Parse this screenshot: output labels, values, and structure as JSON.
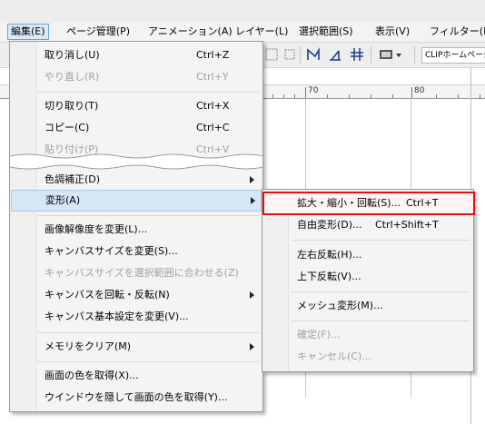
{
  "menubar": {
    "items": [
      {
        "label": "編集(E)"
      },
      {
        "label": "ページ管理(P)"
      },
      {
        "label": "アニメーション(A)"
      },
      {
        "label": "レイヤー(L)"
      },
      {
        "label": "選択範囲(S)"
      },
      {
        "label": "表示(V)"
      },
      {
        "label": "フィルター(I)"
      }
    ]
  },
  "toolbar": {
    "clip_label": "CLIPホームページ"
  },
  "ruler": {
    "labels": [
      "70",
      "80"
    ]
  },
  "edit_menu": {
    "items": [
      {
        "label": "取り消し(U)",
        "shortcut": "Ctrl+Z",
        "enabled": true
      },
      {
        "label": "やり直し(R)",
        "shortcut": "Ctrl+Y",
        "enabled": false
      },
      {
        "label": "切り取り(T)",
        "shortcut": "Ctrl+X",
        "enabled": true
      },
      {
        "label": "コピー(C)",
        "shortcut": "Ctrl+C",
        "enabled": true
      },
      {
        "label": "貼り付け(P)",
        "shortcut": "Ctrl+V",
        "enabled": false
      },
      {
        "label": "色調補正(D)",
        "submenu": true,
        "enabled": true
      },
      {
        "label": "変形(A)",
        "submenu": true,
        "enabled": true,
        "highlighted": true
      },
      {
        "label": "画像解像度を変更(L)...",
        "enabled": true
      },
      {
        "label": "キャンバスサイズを変更(S)...",
        "enabled": true
      },
      {
        "label": "キャンバスサイズを選択範囲に合わせる(Z)",
        "enabled": false
      },
      {
        "label": "キャンバスを回転・反転(N)",
        "submenu": true,
        "enabled": true
      },
      {
        "label": "キャンバス基本設定を変更(V)...",
        "enabled": true
      },
      {
        "label": "メモリをクリア(M)",
        "submenu": true,
        "enabled": true
      },
      {
        "label": "画面の色を取得(X)...",
        "enabled": true
      },
      {
        "label": "ウインドウを隠して画面の色を取得(Y)...",
        "enabled": true
      }
    ]
  },
  "transform_submenu": {
    "items": [
      {
        "label": "拡大・縮小・回転(S)...",
        "shortcut": "Ctrl+T",
        "enabled": true,
        "outlined": true
      },
      {
        "label": "自由変形(D)...",
        "shortcut": "Ctrl+Shift+T",
        "enabled": true
      },
      {
        "label": "左右反転(H)...",
        "enabled": true
      },
      {
        "label": "上下反転(V)...",
        "enabled": true
      },
      {
        "label": "メッシュ変形(M)...",
        "enabled": true
      },
      {
        "label": "確定(F)...",
        "enabled": false
      },
      {
        "label": "キャンセル(C)...",
        "enabled": false
      }
    ]
  },
  "colors": {
    "outline_red": "#e01010",
    "highlight": "#d5e6f6"
  }
}
